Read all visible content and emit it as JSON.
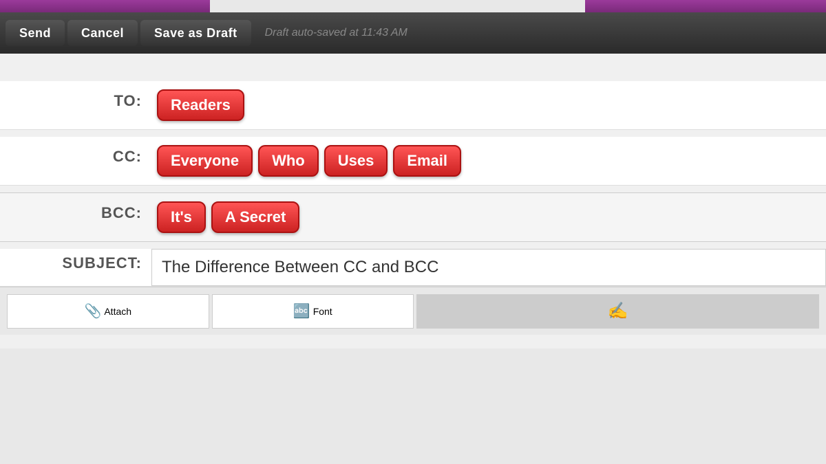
{
  "topbar": {
    "leftColor": "#7a2a7a",
    "rightColor": "#7a2a7a"
  },
  "toolbar": {
    "send_label": "Send",
    "cancel_label": "Cancel",
    "save_draft_label": "Save as Draft",
    "draft_status": "Draft auto-saved at 11:43 AM"
  },
  "form": {
    "to_label": "TO:",
    "cc_label": "CC:",
    "bcc_label": "BCC:",
    "subject_label": "SUBJECT:",
    "to_recipients": [
      {
        "name": "Readers"
      }
    ],
    "cc_recipients": [
      {
        "name": "Everyone"
      },
      {
        "name": "Who"
      },
      {
        "name": "Uses"
      },
      {
        "name": "Email"
      }
    ],
    "bcc_recipients": [
      {
        "name": "It's"
      },
      {
        "name": "A Secret"
      }
    ],
    "subject_value": "The Difference Between CC and BCC"
  },
  "format_toolbar": {
    "attach_label": "Attach",
    "font_label": "Font"
  }
}
